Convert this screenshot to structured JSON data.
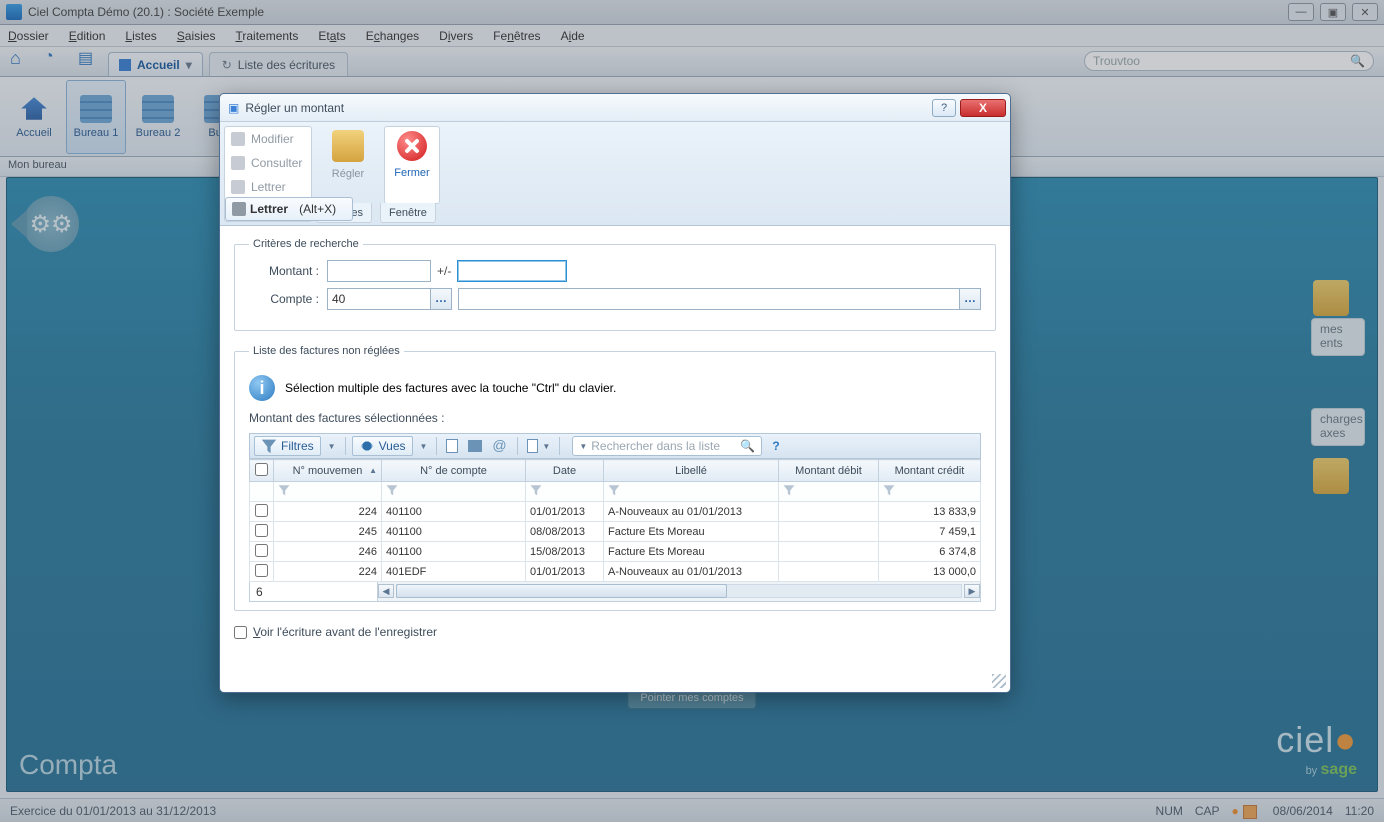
{
  "app_title": "Ciel Compta Démo (20.1) : Société Exemple",
  "menu": [
    "Dossier",
    "Edition",
    "Listes",
    "Saisies",
    "Traitements",
    "Etats",
    "Echanges",
    "Divers",
    "Fenêtres",
    "Aide"
  ],
  "tab_accueil": "Accueil",
  "tab_ecritures": "Liste des écritures",
  "search_placeholder": "Trouvtoo",
  "ribbon": {
    "accueil": "Accueil",
    "bureau1": "Bureau 1",
    "bureau2": "Bureau 2",
    "bureau3": "Bure"
  },
  "bureau_label": "Mon bureau",
  "content": {
    "compta": "Compta",
    "pointer": "Pointer mes comptes",
    "logo_big": "ciel",
    "logo_by": "by",
    "logo_sage": "sage"
  },
  "side": {
    "c1a": "mes",
    "c1b": "ents",
    "c2a": "charges",
    "c2b": "axes"
  },
  "status": {
    "exercice": "Exercice du 01/01/2013 au 31/12/2013",
    "num": "NUM",
    "cap": "CAP",
    "date": "08/06/2014",
    "time": "11:20"
  },
  "dialog": {
    "title": "Régler un montant",
    "tb": {
      "modifier": "Modifier",
      "consulter": "Consulter",
      "lettrer": "Lettrer",
      "regler": "Régler",
      "fermer": "Fermer",
      "fenetre": "Fenêtre",
      "es": "es",
      "lettrer_tab": "Lettrer",
      "lettrer_key": "(Alt+X)"
    },
    "fs_criteres": "Critères de recherche",
    "lbl_montant": "Montant :",
    "pm": "+/-",
    "lbl_compte": "Compte :",
    "compte_val": "40",
    "fs_liste": "Liste des factures non réglées",
    "info": "Sélection multiple des factures avec la touche \"Ctrl\" du clavier.",
    "sub": "Montant des factures sélectionnées :",
    "gb_filtres": "Filtres",
    "gb_vues": "Vues",
    "g_search": "Rechercher dans la liste",
    "cols": [
      "N° mouvemen",
      "N° de compte",
      "Date",
      "Libellé",
      "Montant débit",
      "Montant crédit"
    ],
    "rows": [
      {
        "mv": "224",
        "cpt": "401100",
        "date": "01/01/2013",
        "lib": "A-Nouveaux au 01/01/2013",
        "deb": "",
        "cre": "13 833,9"
      },
      {
        "mv": "245",
        "cpt": "401100",
        "date": "08/08/2013",
        "lib": "Facture Ets Moreau",
        "deb": "",
        "cre": "7 459,1"
      },
      {
        "mv": "246",
        "cpt": "401100",
        "date": "15/08/2013",
        "lib": "Facture Ets Moreau",
        "deb": "",
        "cre": "6 374,8"
      },
      {
        "mv": "224",
        "cpt": "401EDF",
        "date": "01/01/2013",
        "lib": "A-Nouveaux au 01/01/2013",
        "deb": "",
        "cre": "13 000,0"
      }
    ],
    "count": "6",
    "chk": "Voir l'écriture avant de l'enregistrer"
  }
}
